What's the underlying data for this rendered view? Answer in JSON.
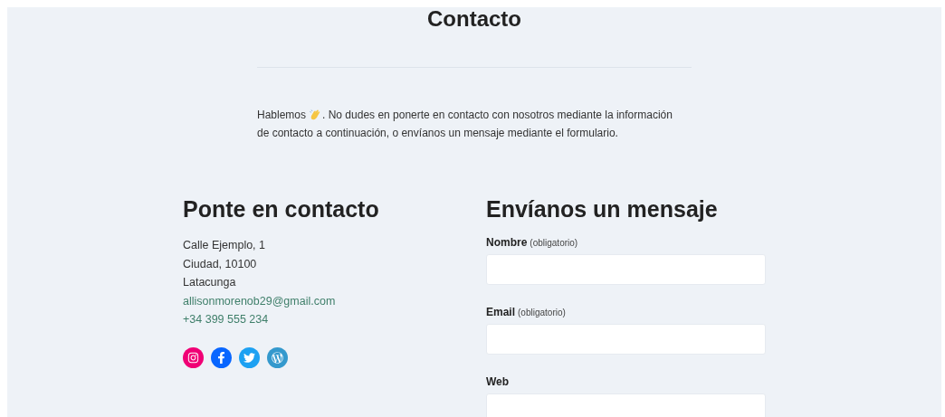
{
  "page_title": "Contacto",
  "intro": {
    "before_icon": "Hablemos",
    "after_icon": ". No dudes en ponerte en contacto con nosotros mediante la información",
    "second_line": "de contacto a continuación, o envíanos un mensaje mediante el formulario."
  },
  "contact": {
    "heading": "Ponte en contacto",
    "address_lines": [
      "Calle Ejemplo, 1",
      "Ciudad, 10100",
      "Latacunga"
    ],
    "email": "allisonmorenob29@gmail.com",
    "phone": "+34 399 555 234",
    "social": [
      {
        "kind": "instagram",
        "color": "#f00075"
      },
      {
        "kind": "facebook",
        "color": "#0866ff"
      },
      {
        "kind": "twitter",
        "color": "#1da1f2"
      },
      {
        "kind": "wordpress",
        "color": "#3499cd"
      }
    ]
  },
  "form": {
    "heading": "Envíanos un mensaje",
    "fields": [
      {
        "label": "Nombre",
        "note": "(obligatorio)"
      },
      {
        "label": "Email",
        "note": "(obligatorio)"
      },
      {
        "label": "Web"
      }
    ]
  }
}
